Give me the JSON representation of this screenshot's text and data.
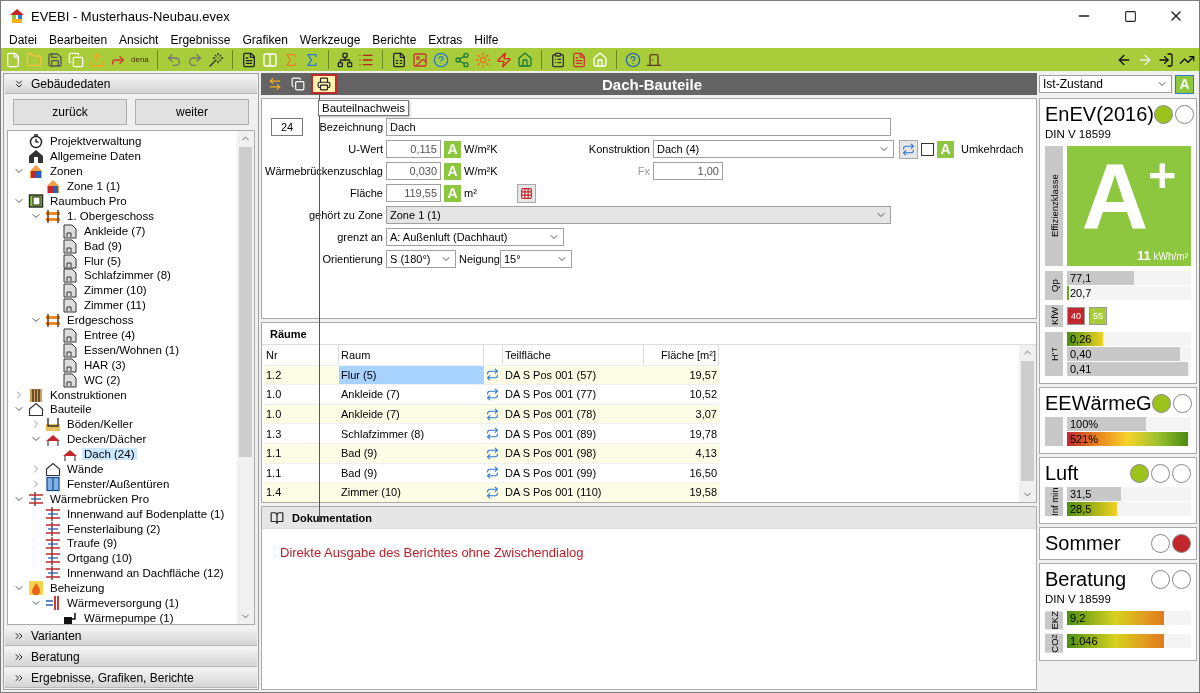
{
  "window": {
    "title": "EVEBI - Musterhaus-Neubau.evex"
  },
  "menu": [
    "Datei",
    "Bearbeiten",
    "Ansicht",
    "Ergebnisse",
    "Grafiken",
    "Werkzeuge",
    "Berichte",
    "Extras",
    "Hilfe"
  ],
  "toolbar": {
    "logo_text": "dena"
  },
  "left_panel": {
    "sections": [
      {
        "label": "Gebäudedaten",
        "expanded": true
      },
      {
        "label": "Varianten",
        "expanded": false
      },
      {
        "label": "Beratung",
        "expanded": false
      },
      {
        "label": "Ergebnisse, Grafiken, Berichte",
        "expanded": false
      }
    ],
    "buttons": [
      "zurück",
      "weiter"
    ],
    "tree": [
      {
        "label": "Projektverwaltung",
        "kind": "clock",
        "selected": false
      },
      {
        "label": "Allgemeine Daten",
        "kind": "house",
        "selected": false
      },
      {
        "label": "Zonen",
        "kind": "zone",
        "selected": false,
        "expanded": true,
        "children": [
          {
            "label": "Zone 1 (1)",
            "kind": "zone",
            "selected": false
          }
        ]
      },
      {
        "label": "Raumbuch Pro",
        "kind": "book",
        "selected": false,
        "expanded": true,
        "children": [
          {
            "label": "1. Obergeschoss",
            "kind": "floor",
            "selected": false,
            "expanded": true,
            "children": [
              {
                "label": "Ankleide (7)",
                "kind": "room",
                "selected": false
              },
              {
                "label": "Bad (9)",
                "kind": "room",
                "selected": false
              },
              {
                "label": "Flur (5)",
                "kind": "room",
                "selected": false
              },
              {
                "label": "Schlafzimmer (8)",
                "kind": "room",
                "selected": false
              },
              {
                "label": "Zimmer (10)",
                "kind": "room",
                "selected": false
              },
              {
                "label": "Zimmer (11)",
                "kind": "room",
                "selected": false
              }
            ]
          },
          {
            "label": "Erdgeschoss",
            "kind": "floor",
            "selected": false,
            "expanded": true,
            "children": [
              {
                "label": "Entree (4)",
                "kind": "room",
                "selected": false
              },
              {
                "label": "Essen/Wohnen (1)",
                "kind": "room",
                "selected": false
              },
              {
                "label": "HAR (3)",
                "kind": "room",
                "selected": false
              },
              {
                "label": "WC (2)",
                "kind": "room",
                "selected": false
              }
            ]
          }
        ]
      },
      {
        "label": "Konstruktionen",
        "kind": "layers",
        "selected": false,
        "expanded": false
      },
      {
        "label": "Bauteile",
        "kind": "outline",
        "selected": false,
        "expanded": true,
        "children": [
          {
            "label": "Böden/Keller",
            "kind": "slab",
            "selected": false,
            "expanded": false
          },
          {
            "label": "Decken/Dächer",
            "kind": "roof",
            "selected": false,
            "expanded": true,
            "children": [
              {
                "label": "Dach (24)",
                "kind": "roof",
                "selected": true
              }
            ]
          },
          {
            "label": "Wände",
            "kind": "outline",
            "selected": false,
            "expanded": false
          },
          {
            "label": "Fenster/Außentüren",
            "kind": "window",
            "selected": false,
            "expanded": false
          }
        ]
      },
      {
        "label": "Wärmebrücken Pro",
        "kind": "bridge",
        "selected": false,
        "expanded": true,
        "children": [
          {
            "label": "Innenwand auf Bodenplatte (1)",
            "kind": "bridge",
            "selected": false
          },
          {
            "label": "Fensterlaibung (2)",
            "kind": "bridge",
            "selected": false
          },
          {
            "label": "Traufe (9)",
            "kind": "bridge",
            "selected": false
          },
          {
            "label": "Ortgang (10)",
            "kind": "bridge",
            "selected": false
          },
          {
            "label": "Innenwand an Dachfläche (12)",
            "kind": "bridge",
            "selected": false
          }
        ]
      },
      {
        "label": "Beheizung",
        "kind": "flame",
        "selected": false,
        "expanded": true,
        "children": [
          {
            "label": "Wärmeversorgung (1)",
            "kind": "pipes",
            "selected": false,
            "expanded": true,
            "children": [
              {
                "label": "Wärmepumpe (1)",
                "kind": "pump",
                "selected": false
              }
            ]
          }
        ]
      }
    ]
  },
  "editor": {
    "title": "Dach-Bauteile",
    "tools": [
      {
        "selected": false
      },
      {
        "selected": false
      },
      {
        "selected": true
      }
    ],
    "tooltip": "Bauteilnachweis",
    "form": {
      "number": "24",
      "name": {
        "label": "Bezeichnung",
        "value": "Dach"
      },
      "u_value": {
        "label": "U-Wert",
        "value": "0,115",
        "badge": "A",
        "unit": "W/m²K"
      },
      "construction": {
        "label": "Konstruktion",
        "value": "Dach (4)",
        "badge": "A",
        "inverted_roof": {
          "label": "Umkehrdach",
          "checked": false
        }
      },
      "thermal_bridge": {
        "label": "Wärmebrückenzuschlag",
        "value": "0,030",
        "badge": "A",
        "unit": "W/m²K"
      },
      "fx": {
        "label": "Fx",
        "value": "1,00",
        "disabled": true
      },
      "area": {
        "label": "Fläche",
        "value": "119,55",
        "badge": "A",
        "unit": "m²"
      },
      "zone": {
        "label": "gehört zu Zone",
        "value": "Zone 1 (1)",
        "disabled": true
      },
      "adjacent": {
        "label": "grenzt an",
        "value": "A: Außenluft (Dachhaut)"
      },
      "orientation": {
        "label": "Orientierung",
        "value": "S (180°)"
      },
      "inclination": {
        "label": "Neigung",
        "value": "15°"
      }
    },
    "rooms": {
      "title": "Räume",
      "columns": [
        "Nr",
        "Raum",
        "Teilfläche",
        "Fläche [m²]"
      ],
      "rows": [
        {
          "nr": "1.2",
          "room": "Flur (5)",
          "part": "DA S Pos 001 (57)",
          "area": "19,57",
          "selected": true
        },
        {
          "nr": "1.0",
          "room": "Ankleide (7)",
          "part": "DA S Pos 001 (77)",
          "area": "10,52",
          "selected": false
        },
        {
          "nr": "1.0",
          "room": "Ankleide (7)",
          "part": "DA S Pos 001 (78)",
          "area": "3,07",
          "selected": false
        },
        {
          "nr": "1.3",
          "room": "Schlafzimmer (8)",
          "part": "DA S Pos 001 (89)",
          "area": "19,78",
          "selected": false
        },
        {
          "nr": "1.1",
          "room": "Bad (9)",
          "part": "DA S Pos 001 (98)",
          "area": "4,13",
          "selected": false
        },
        {
          "nr": "1.1",
          "room": "Bad (9)",
          "part": "DA S Pos 001 (99)",
          "area": "16,50",
          "selected": false
        },
        {
          "nr": "1.4",
          "room": "Zimmer (10)",
          "part": "DA S Pos 001 (110)",
          "area": "19,58",
          "selected": false
        }
      ]
    },
    "documentation": {
      "title": "Dokumentation"
    }
  },
  "annotation": "Direkte Ausgabe des Berichtes ohne Zwischendialog",
  "right_panel": {
    "state_select": "Ist-Zustand",
    "badge": "A",
    "sections": [
      {
        "title": "EnEV(2016)",
        "lights": [
          {
            "color": "#9bc31c"
          },
          {
            "color": "#ffffff"
          }
        ],
        "subtitle": "DIN V 18599",
        "efficiency": {
          "label": "Effizienzklasse",
          "class": "A$^{+}$",
          "value": "11",
          "unit": "kWh/m²"
        },
        "groups": [
          {
            "label": "Qp",
            "bars": [
              {
                "text": "77,1",
                "level": 0.55,
                "kind": "grey"
              },
              {
                "text": "20,7",
                "level": 0,
                "kind": "marker"
              }
            ]
          },
          {
            "label": "KfW",
            "badges": [
              {
                "text": "40",
                "color": "#c1272d"
              },
              {
                "text": "55",
                "color": "#a9cd3a"
              }
            ]
          },
          {
            "label": "H'$_{T}$",
            "bars": [
              {
                "text": "0,26",
                "level": 0.3,
                "kind": "green-yellow"
              },
              {
                "text": "0,40",
                "level": 0.93,
                "kind": "grey"
              },
              {
                "text": "0,41",
                "level": 1,
                "kind": "grey"
              }
            ]
          }
        ]
      },
      {
        "title": "EEWärmeG",
        "lights": [
          {
            "color": "#9bc31c"
          },
          {
            "color": "#ffffff"
          }
        ],
        "groups": [
          {
            "bars": [
              {
                "text": "100%",
                "level": 0.65,
                "kind": "grey"
              },
              {
                "text": "521%",
                "level": 1,
                "kind": "rainbow"
              }
            ]
          }
        ]
      },
      {
        "title": "Luft",
        "lights": [
          {
            "color": "#9bc31c"
          },
          {
            "color": "#ffffff"
          },
          {
            "color": "#ffffff"
          }
        ],
        "groups": [
          {
            "label": "Inf min",
            "bars": [
              {
                "text": "31,5",
                "level": 0.45,
                "kind": "grey"
              },
              {
                "text": "28,5",
                "level": 0.41,
                "kind": "green-yellow"
              }
            ]
          }
        ]
      },
      {
        "title": "Sommer",
        "lights": [
          {
            "color": "#ffffff"
          },
          {
            "color": "#c1272d"
          }
        ]
      },
      {
        "title": "Beratung",
        "lights": [
          {
            "color": "#ffffff"
          },
          {
            "color": "#ffffff"
          }
        ],
        "subtitle": "DIN V 18599",
        "groups": [
          {
            "label": "EKZ",
            "bars": [
              {
                "text": "9,2",
                "level": 0.8,
                "kind": "green-orange"
              }
            ]
          },
          {
            "label": "CO$_{2}$",
            "bars": [
              {
                "text": "1.046",
                "level": 0.8,
                "kind": "green-orange"
              }
            ]
          }
        ]
      }
    ]
  }
}
